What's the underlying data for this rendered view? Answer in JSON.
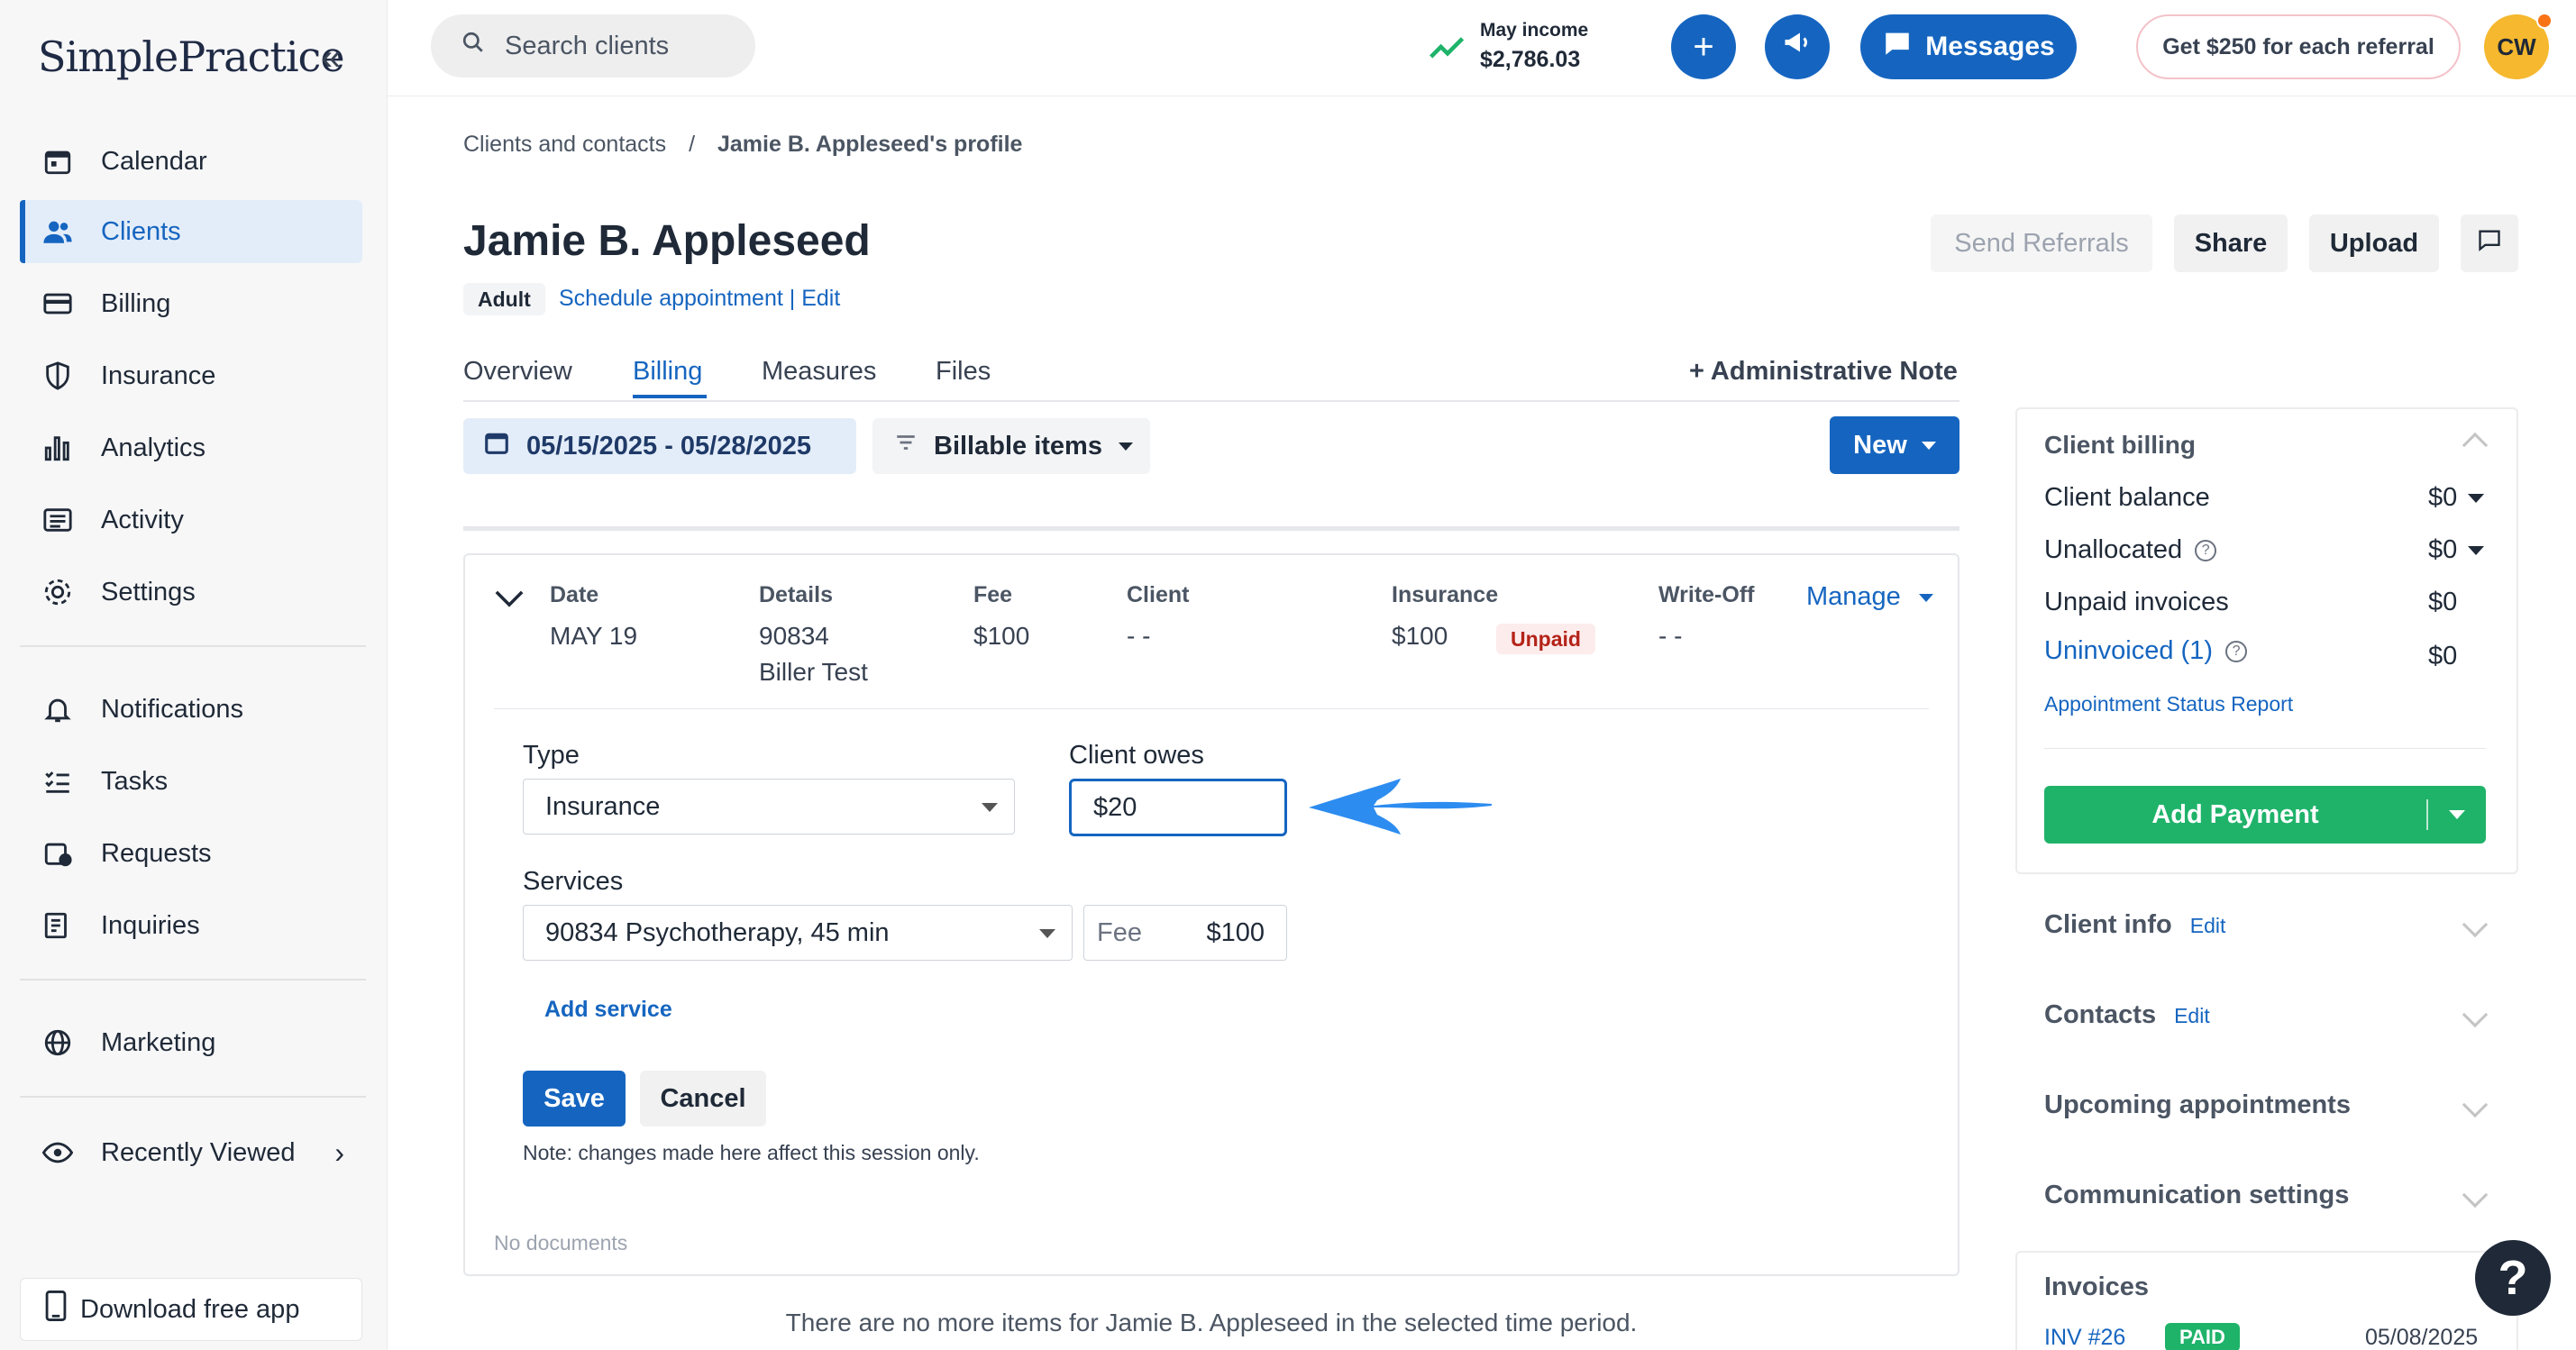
{
  "app": {
    "logo": "SimplePractice"
  },
  "sidebar": {
    "items": [
      {
        "label": "Calendar",
        "icon": "calendar-icon"
      },
      {
        "label": "Clients",
        "icon": "users-icon",
        "active": true
      },
      {
        "label": "Billing",
        "icon": "credit-card-icon"
      },
      {
        "label": "Insurance",
        "icon": "shield-icon"
      },
      {
        "label": "Analytics",
        "icon": "bar-chart-icon"
      },
      {
        "label": "Activity",
        "icon": "list-icon"
      },
      {
        "label": "Settings",
        "icon": "gear-icon"
      },
      {
        "label": "Notifications",
        "icon": "bell-icon"
      },
      {
        "label": "Tasks",
        "icon": "checklist-icon"
      },
      {
        "label": "Requests",
        "icon": "calendar-clock-icon"
      },
      {
        "label": "Inquiries",
        "icon": "inquiry-icon"
      },
      {
        "label": "Marketing",
        "icon": "globe-icon"
      },
      {
        "label": "Recently Viewed",
        "icon": "eye-icon"
      }
    ],
    "download_app": "Download free app"
  },
  "topbar": {
    "search_placeholder": "Search clients",
    "income_label": "May income",
    "income_value": "$2,786.03",
    "messages_label": "Messages",
    "referral_label": "Get $250 for each referral",
    "avatar_initials": "CW"
  },
  "breadcrumb": {
    "parent": "Clients and contacts",
    "separator": "/",
    "current": "Jamie B. Appleseed's profile"
  },
  "client": {
    "name": "Jamie B. Appleseed",
    "badge": "Adult",
    "schedule_link": "Schedule appointment",
    "pipe": "|",
    "edit_link": "Edit"
  },
  "header_actions": {
    "send_referrals": "Send Referrals",
    "share": "Share",
    "upload": "Upload"
  },
  "tabs": [
    {
      "label": "Overview"
    },
    {
      "label": "Billing",
      "active": true
    },
    {
      "label": "Measures"
    },
    {
      "label": "Files"
    }
  ],
  "admin_note": "+ Administrative Note",
  "filters": {
    "date_range": "05/15/2025 - 05/28/2025",
    "billable_items": "Billable items",
    "new_button": "New"
  },
  "billing_item": {
    "headers": {
      "date": "Date",
      "details": "Details",
      "fee": "Fee",
      "client": "Client",
      "insurance": "Insurance",
      "writeoff": "Write-Off"
    },
    "date": "MAY 19",
    "details_code": "90834",
    "details_biller": "Biller Test",
    "fee": "$100",
    "client": "- -",
    "insurance": "$100",
    "insurance_status": "Unpaid",
    "writeoff": "- -",
    "manage": "Manage"
  },
  "edit_form": {
    "type_label": "Type",
    "type_value": "Insurance",
    "client_owes_label": "Client owes",
    "client_owes_value": "$20",
    "services_label": "Services",
    "service_value": "90834 Psychotherapy, 45 min",
    "fee_placeholder": "Fee",
    "fee_value": "$100",
    "add_service": "Add service",
    "save": "Save",
    "cancel": "Cancel",
    "note": "Note: changes made here affect this session only.",
    "no_documents": "No documents"
  },
  "no_more_items": "There are no more items for Jamie B. Appleseed in the selected time period.",
  "right_panel": {
    "client_billing_title": "Client billing",
    "client_balance_label": "Client balance",
    "client_balance_value": "$0",
    "unallocated_label": "Unallocated",
    "unallocated_value": "$0",
    "unpaid_invoices_label": "Unpaid invoices",
    "unpaid_invoices_value": "$0",
    "uninvoiced_label": "Uninvoiced (1)",
    "uninvoiced_value": "$0",
    "status_report_link": "Appointment Status Report",
    "add_payment": "Add Payment",
    "sections": [
      {
        "label": "Client info",
        "edit": "Edit"
      },
      {
        "label": "Contacts",
        "edit": "Edit"
      },
      {
        "label": "Upcoming appointments"
      },
      {
        "label": "Communication settings"
      }
    ],
    "invoices_title": "Invoices",
    "invoice_id": "INV #26",
    "invoice_status": "PAID",
    "invoice_date": "05/08/2025"
  },
  "colors": {
    "accent": "#1565c0",
    "success": "#1fb36a",
    "danger": "#b42318",
    "arrow": "#2d8cf0"
  }
}
